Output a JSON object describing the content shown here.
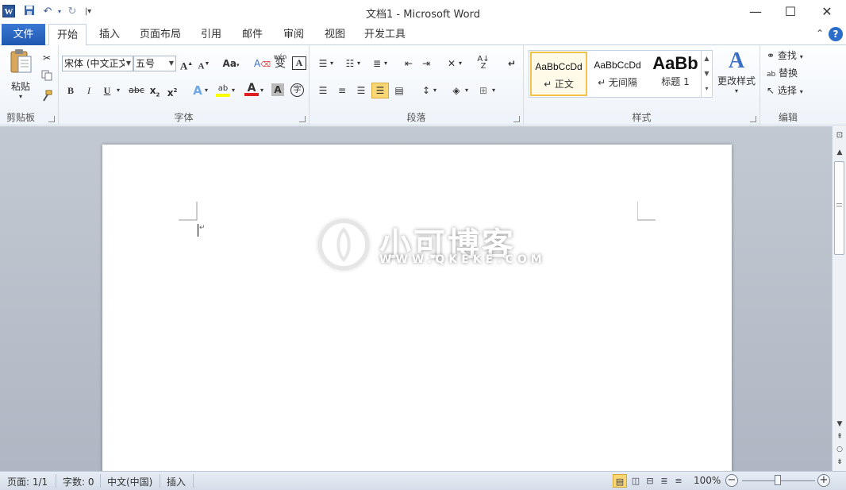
{
  "window": {
    "title": "文档1 - Microsoft Word",
    "app_icon_letter": "W",
    "controls": {
      "minimize": "—",
      "maximize": "☐",
      "close": "✕"
    }
  },
  "quick_access": {
    "save_icon": "save-icon",
    "undo_icon": "undo-icon",
    "redo_icon": "redo-icon",
    "customize_icon": "customize-icon"
  },
  "tabs": {
    "file": "文件",
    "items": [
      "开始",
      "插入",
      "页面布局",
      "引用",
      "邮件",
      "审阅",
      "视图",
      "开发工具"
    ],
    "active": "开始"
  },
  "ribbon": {
    "clipboard": {
      "label": "剪贴板",
      "paste": "粘贴"
    },
    "font": {
      "label": "字体",
      "font_name": "宋体 (中文正文",
      "font_size": "五号",
      "change_case": "Aa",
      "phonetic": "wén"
    },
    "paragraph": {
      "label": "段落"
    },
    "styles": {
      "label": "样式",
      "items": [
        {
          "preview": "AaBbCcDd",
          "name": "↵ 正文"
        },
        {
          "preview": "AaBbCcDd",
          "name": "↵ 无间隔"
        },
        {
          "preview": "AaBb",
          "name": "标题 1"
        }
      ],
      "change_styles": "更改样式"
    },
    "editing": {
      "label": "编辑",
      "find": "查找",
      "replace": "替换",
      "select": "选择"
    }
  },
  "document": {
    "watermark_title": "小可博客",
    "watermark_url": "WWW.QKEKE.COM",
    "paragraph_mark": "↵"
  },
  "statusbar": {
    "page": "页面: 1/1",
    "words": "字数: 0",
    "language": "中文(中国)",
    "mode": "插入",
    "zoom": "100%",
    "zoom_level": 1.0
  },
  "colors": {
    "file_tab": "#2b64c2",
    "highlight_yellow": "#ffff00",
    "font_red": "#e02020",
    "selected_style_border": "#f3c24c"
  }
}
